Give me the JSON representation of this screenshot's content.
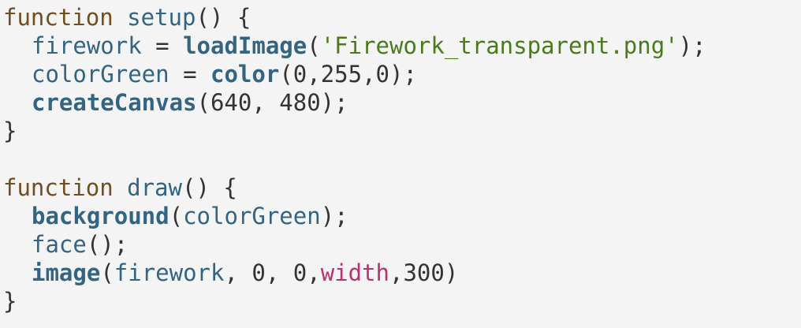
{
  "editor": {
    "colors": {
      "background": "#f4f4f4",
      "keyword": "#704f21",
      "identifier": "#336582",
      "string": "#4a7a1c",
      "constant": "#b9316e",
      "punctuation": "#333333"
    },
    "lines": [
      {
        "indent": 0,
        "tokens": [
          {
            "text": "function ",
            "kind": "kw"
          },
          {
            "text": "setup",
            "kind": "fn"
          },
          {
            "text": "() {",
            "kind": "pun"
          }
        ]
      },
      {
        "indent": 1,
        "tokens": [
          {
            "text": "firework",
            "kind": "var"
          },
          {
            "text": " = ",
            "kind": "pun"
          },
          {
            "text": "loadImage",
            "kind": "bi"
          },
          {
            "text": "(",
            "kind": "pun"
          },
          {
            "text": "'Firework_transparent.png'",
            "kind": "str"
          },
          {
            "text": ");",
            "kind": "pun"
          }
        ]
      },
      {
        "indent": 1,
        "tokens": [
          {
            "text": "colorGreen",
            "kind": "var"
          },
          {
            "text": " = ",
            "kind": "pun"
          },
          {
            "text": "color",
            "kind": "bi"
          },
          {
            "text": "(0,255,0);",
            "kind": "pun"
          }
        ]
      },
      {
        "indent": 1,
        "tokens": [
          {
            "text": "createCanvas",
            "kind": "bi"
          },
          {
            "text": "(640, 480);",
            "kind": "pun"
          }
        ]
      },
      {
        "indent": 0,
        "tokens": [
          {
            "text": "}",
            "kind": "pun"
          }
        ]
      },
      {
        "indent": 0,
        "tokens": []
      },
      {
        "indent": 0,
        "tokens": [
          {
            "text": "function ",
            "kind": "kw"
          },
          {
            "text": "draw",
            "kind": "fn"
          },
          {
            "text": "() {",
            "kind": "pun"
          }
        ]
      },
      {
        "indent": 1,
        "tokens": [
          {
            "text": "background",
            "kind": "bi"
          },
          {
            "text": "(",
            "kind": "pun"
          },
          {
            "text": "colorGreen",
            "kind": "var"
          },
          {
            "text": ");",
            "kind": "pun"
          }
        ]
      },
      {
        "indent": 1,
        "tokens": [
          {
            "text": "face",
            "kind": "var"
          },
          {
            "text": "();",
            "kind": "pun"
          }
        ]
      },
      {
        "indent": 1,
        "tokens": [
          {
            "text": "image",
            "kind": "bi"
          },
          {
            "text": "(",
            "kind": "pun"
          },
          {
            "text": "firework",
            "kind": "var"
          },
          {
            "text": ", 0, 0,",
            "kind": "pun"
          },
          {
            "text": "width",
            "kind": "cst"
          },
          {
            "text": ",300)",
            "kind": "pun"
          }
        ]
      },
      {
        "indent": 0,
        "tokens": [
          {
            "text": "}",
            "kind": "pun"
          }
        ]
      }
    ]
  }
}
